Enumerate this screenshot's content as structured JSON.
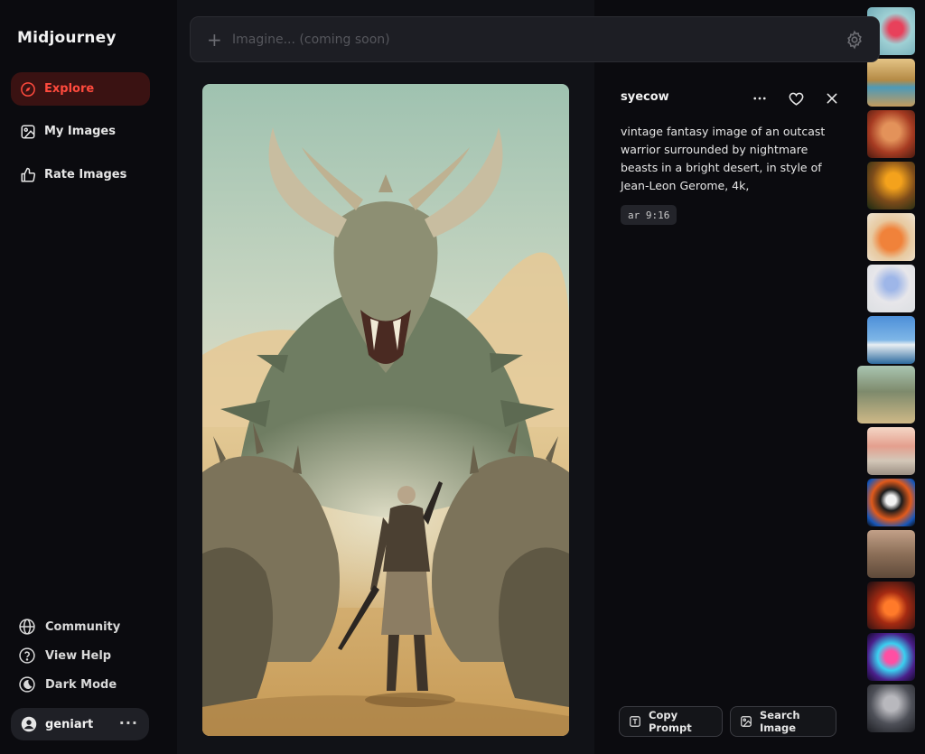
{
  "app": {
    "brand": "Midjourney"
  },
  "sidebar": {
    "nav": [
      {
        "label": "Explore",
        "icon": "compass-icon",
        "active": true
      },
      {
        "label": "My Images",
        "icon": "image-icon",
        "active": false
      },
      {
        "label": "Rate Images",
        "icon": "thumbs-up-icon",
        "active": false
      }
    ],
    "bottom": [
      {
        "label": "Community",
        "icon": "globe-icon"
      },
      {
        "label": "View Help",
        "icon": "help-icon"
      },
      {
        "label": "Dark Mode",
        "icon": "moon-icon"
      }
    ],
    "user": {
      "name": "geniart",
      "more": "···"
    }
  },
  "search": {
    "placeholder": "Imagine... (coming soon)",
    "value": ""
  },
  "detail": {
    "author": "syecow",
    "prompt": "vintage fantasy image of an outcast warrior surrounded by nightmare beasts in a bright desert, in style of Jean-Leon Gerome, 4k,",
    "param": "ar 9:16",
    "copy_label": "Copy Prompt",
    "search_label": "Search Image"
  },
  "colors": {
    "accent": "#ff4a3d",
    "active_bg": "#3a1212",
    "panel": "#111217",
    "bg": "#0b0b0f"
  }
}
